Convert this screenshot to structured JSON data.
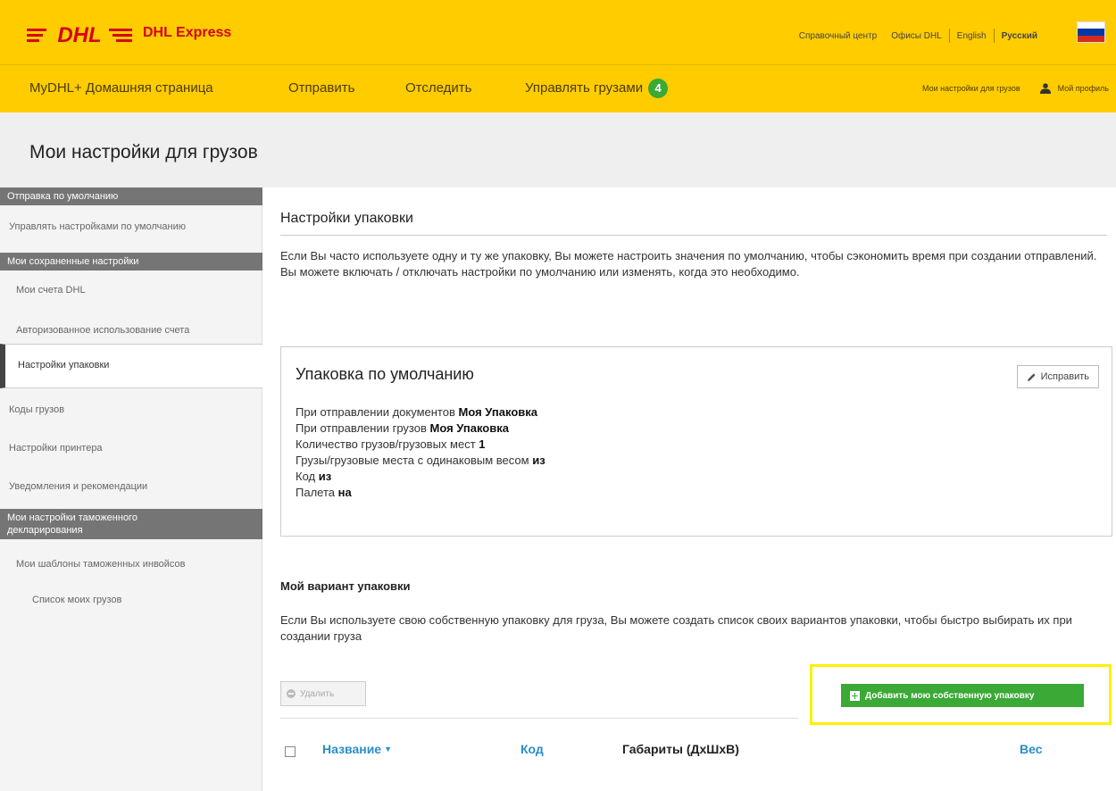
{
  "colors": {
    "brand_yellow": "#ffcc00",
    "brand_red": "#d40511",
    "action_green": "#3aa935",
    "link_blue": "#2a8ec7",
    "highlight_yellow": "#fcf000"
  },
  "header": {
    "logo_text": "DHL",
    "logo_sub": "DHL Express",
    "links": {
      "help": "Справочный центр",
      "offices": "Офисы DHL",
      "english": "English",
      "russian": "Русский"
    }
  },
  "nav": {
    "home": "MyDHL+ Домашняя страница",
    "send": "Отправить",
    "track": "Отследить",
    "manage": "Управлять грузами",
    "manage_badge": "4",
    "settings": "Мои настройки для грузов",
    "profile": "Мой профиль",
    "profile_icon": "user-icon"
  },
  "page_title": "Мои настройки для грузов",
  "sidebar": {
    "heading1": "Отправка по умолчанию",
    "item1": "Управлять настройками по умолчанию",
    "heading2": "Мои сохраненные настройки",
    "item2": "Мои счета DHL",
    "item3": "Авторизованное использование счета",
    "item4": "Настройки упаковки",
    "item5": "Коды грузов",
    "item6": "Настройки принтера",
    "item7": "Уведомления и рекомендации",
    "heading3_line1": "Мои настройки таможенного",
    "heading3_line2": "декларирования",
    "item8": "Мои шаблоны таможенных инвойсов",
    "item9": "Список моих грузов"
  },
  "main": {
    "section_title": "Настройки упаковки",
    "intro": "Если Вы часто используете одну и ту же упаковку, Вы можете настроить значения по умолчанию, чтобы сэкономить время при создании отправлений. Вы можете включать / отключать настройки по умолчанию или изменять, когда это необходимо.",
    "card": {
      "title": "Упаковка по умолчанию",
      "edit_label": "Исправить",
      "line1_label": "При отправлении документов",
      "line1_value": "Моя Упаковка",
      "line2_label": "При отправлении грузов",
      "line2_value": "Моя Упаковка",
      "line3_label": "Количество грузов/грузовых мест",
      "line3_value": "1",
      "line4_label": "Грузы/грузовые места с одинаковым весом",
      "line4_value": "из",
      "line5_label": "Код",
      "line5_value": "из",
      "line6_label": "Палета",
      "line6_value": "на"
    },
    "custom_title": "Мой вариант упаковки",
    "custom_text": "Если Вы используете свою собственную упаковку для груза, Вы можете создать список своих вариантов упаковки, чтобы быстро выбирать их при создании груза",
    "delete_label": "Удалить",
    "add_label": "Добавить мою собственную упаковку",
    "table_headers": {
      "name": "Название",
      "code": "Код",
      "dims": "Габариты (ДхШхВ)",
      "weight": "Вес"
    }
  }
}
